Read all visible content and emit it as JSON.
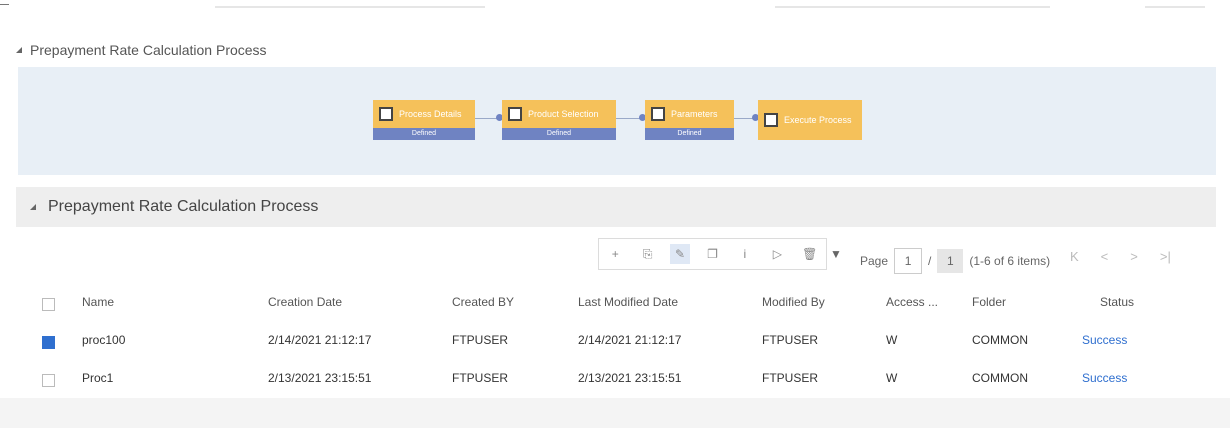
{
  "section1": {
    "title": "Prepayment Rate Calculation Process"
  },
  "flow": {
    "nodes": [
      {
        "label": "Process Details",
        "status": "Defined"
      },
      {
        "label": "Product Selection",
        "status": "Defined"
      },
      {
        "label": "Parameters",
        "status": "Defined"
      },
      {
        "label": "Execute Process",
        "status": ""
      }
    ]
  },
  "section2": {
    "title": "Prepayment Rate Calculation Process"
  },
  "toolbar": {
    "buttons": [
      "+",
      "⎘",
      "✎",
      "❐",
      "i",
      "▷",
      "🗑"
    ],
    "filter": "▼"
  },
  "pager": {
    "label": "Page",
    "current": "1",
    "separator": "/",
    "total": "1",
    "range": "(1-6 of 6 items)",
    "nav": [
      "K",
      "<",
      ">",
      ">|"
    ]
  },
  "table": {
    "headers": [
      "Name",
      "Creation Date",
      "Created BY",
      "Last Modified Date",
      "Modified By",
      "Access ...",
      "Folder",
      "Status"
    ],
    "rows": [
      {
        "name": "proc100",
        "creation_date": "2/14/2021 21:12:17",
        "created_by": "FTPUSER",
        "last_modified": "2/14/2021 21:12:17",
        "modified_by": "FTPUSER",
        "access": "W",
        "folder": "COMMON",
        "status": "Success",
        "checked": true
      },
      {
        "name": "Proc1",
        "creation_date": "2/13/2021 23:15:51",
        "created_by": "FTPUSER",
        "last_modified": "2/13/2021 23:15:51",
        "modified_by": "FTPUSER",
        "access": "W",
        "folder": "COMMON",
        "status": "Success",
        "checked": false
      }
    ]
  }
}
